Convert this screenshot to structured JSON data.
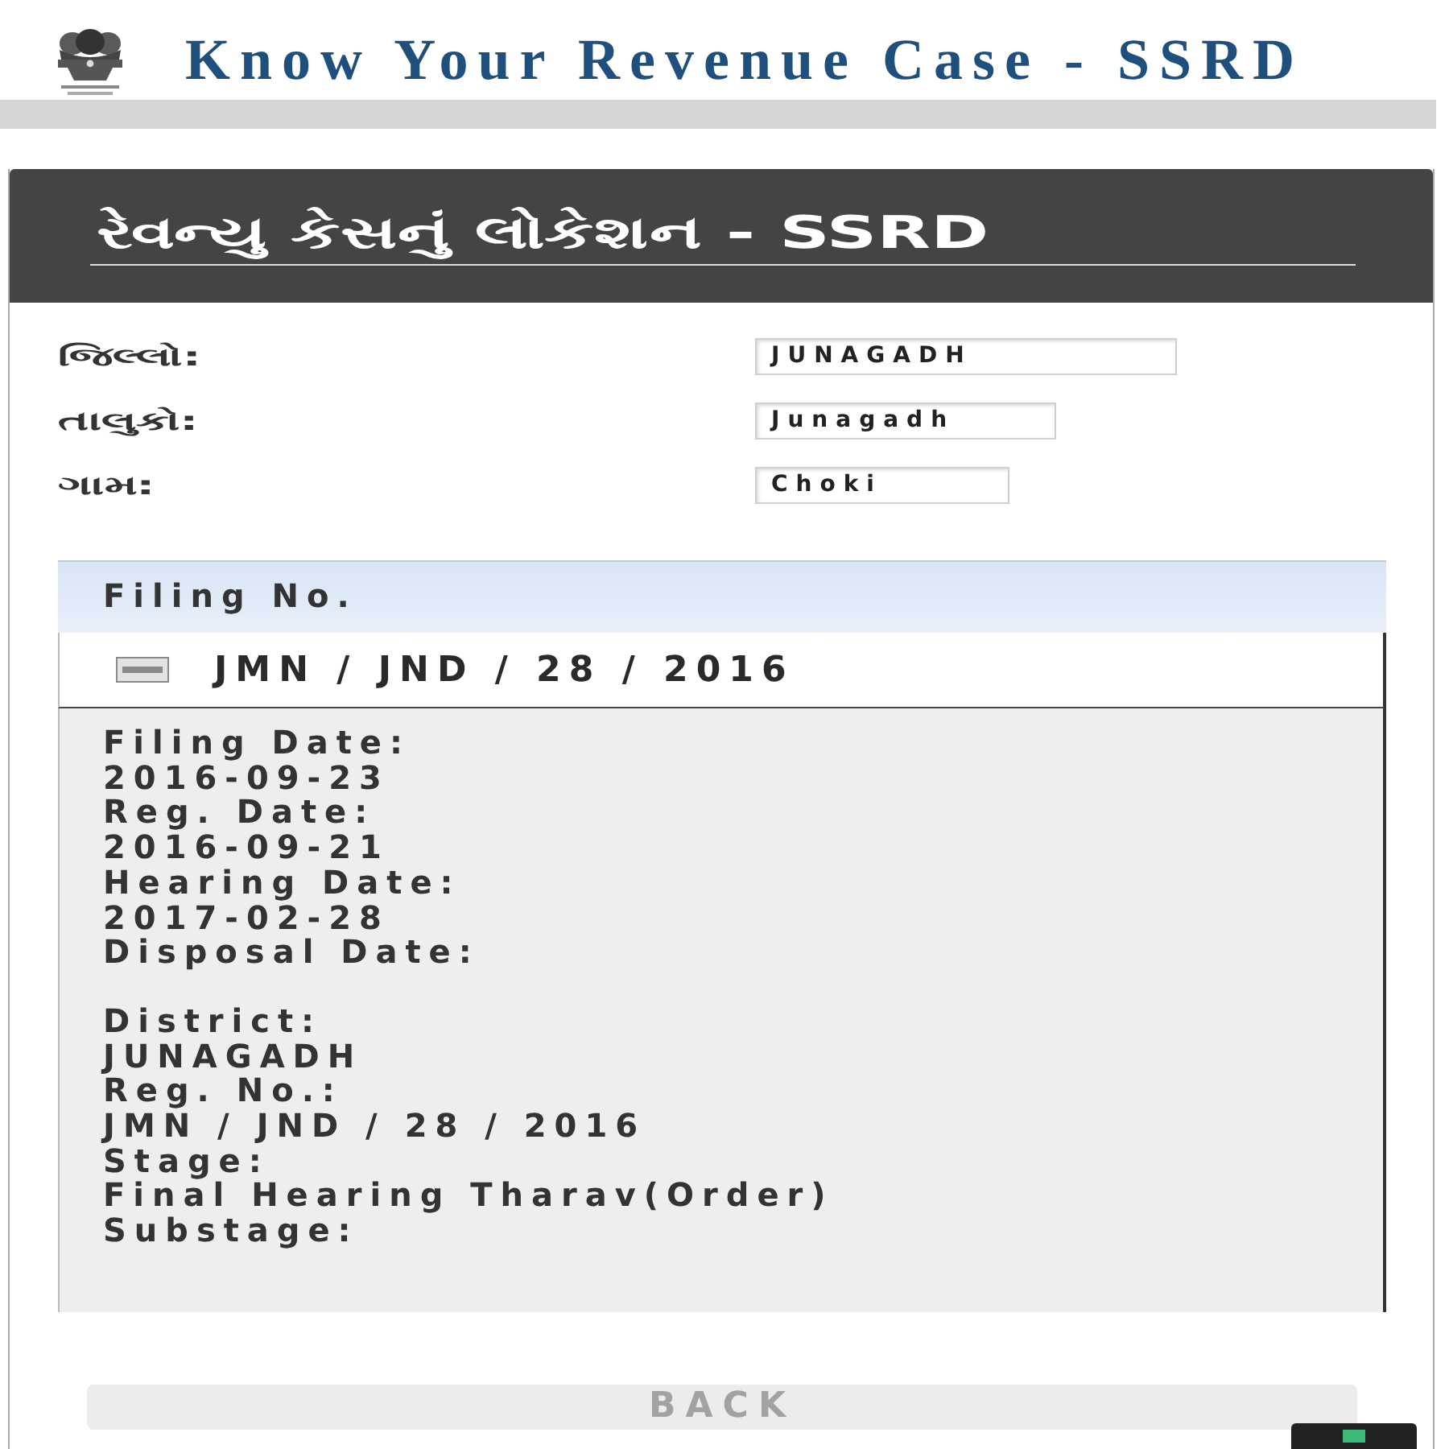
{
  "header": {
    "title": "Know Your Revenue Case - SSRD"
  },
  "panel": {
    "title": "રેવન્યુ કેસનું લોકેશન - SSRD"
  },
  "form": {
    "fields": [
      {
        "label": "જિલ્લો:",
        "value": "JUNAGADH"
      },
      {
        "label": "તાલુકો:",
        "value": "Junagadh"
      },
      {
        "label": "ગામ:",
        "value": "Choki"
      }
    ]
  },
  "accordion": {
    "heading": "Filing No.",
    "items": [
      {
        "title": "JMN / JND / 28 / 2016",
        "expanded": true,
        "sections": [
          {
            "fields": [
              {
                "label": "Filing Date:",
                "value": "2016-09-23"
              },
              {
                "label": "Reg. Date:",
                "value": "2016-09-21"
              },
              {
                "label": "Hearing Date:",
                "value": "2017-02-28"
              },
              {
                "label": "Disposal Date:"
              }
            ]
          },
          {
            "fields": [
              {
                "label": "District:",
                "value": "JUNAGADH"
              },
              {
                "label": "Reg. No.:",
                "value": "JMN / JND / 28 / 2016"
              },
              {
                "label": "Stage:",
                "value": "Final Hearing Tharav(Order)"
              },
              {
                "label": "Substage:"
              }
            ]
          }
        ]
      }
    ]
  },
  "back_button": {
    "label": "BACK"
  }
}
